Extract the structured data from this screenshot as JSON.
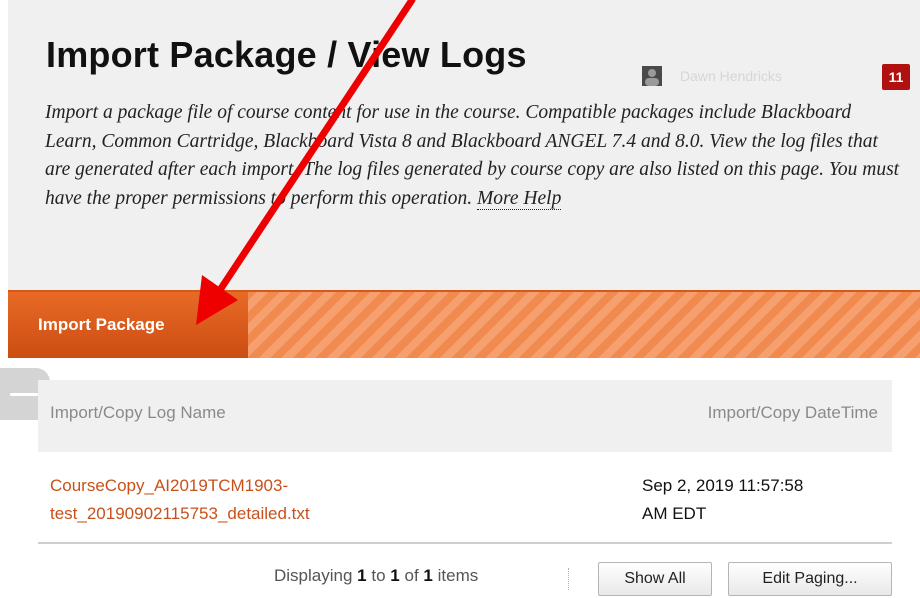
{
  "header": {
    "title": "Import Package / View Logs",
    "user_name": "Dawn Hendricks",
    "notification_count": "11",
    "description": "Import a package file of course content for use in the course. Compatible packages include Blackboard Learn, Common Cartridge, Blackboard Vista 8 and Blackboard ANGEL 7.4 and 8.0. View the log files that are generated after each import. The log files generated by course copy are also listed on this page. You must have the proper permissions to perform this operation.",
    "more_help": "More Help"
  },
  "action_bar": {
    "import_package_label": "Import Package"
  },
  "table": {
    "columns": [
      "Import/Copy Log Name",
      "Import/Copy DateTime"
    ],
    "rows": [
      {
        "name": "CourseCopy_AI2019TCM1903-test_20190902115753_detailed.txt",
        "name_line1": "CourseCopy_AI2019TCM1903-",
        "name_line2": "test_20190902115753_detailed.txt",
        "datetime_line1": "Sep 2, 2019 11:57:58",
        "datetime_line2": "AM EDT"
      }
    ]
  },
  "pager": {
    "prefix": "Displaying",
    "from": "1",
    "to_word": "to",
    "to": "1",
    "of_word": "of",
    "total": "1",
    "suffix": "items",
    "show_all_label": "Show All",
    "edit_paging_label": "Edit Paging..."
  },
  "colors": {
    "accent_orange": "#cc4d12",
    "link_orange": "#c8511b",
    "badge_red": "#b01010",
    "annotation_arrow": "#ee0000"
  },
  "annotation": {
    "type": "red-arrow",
    "points_to": "import-package-button"
  }
}
